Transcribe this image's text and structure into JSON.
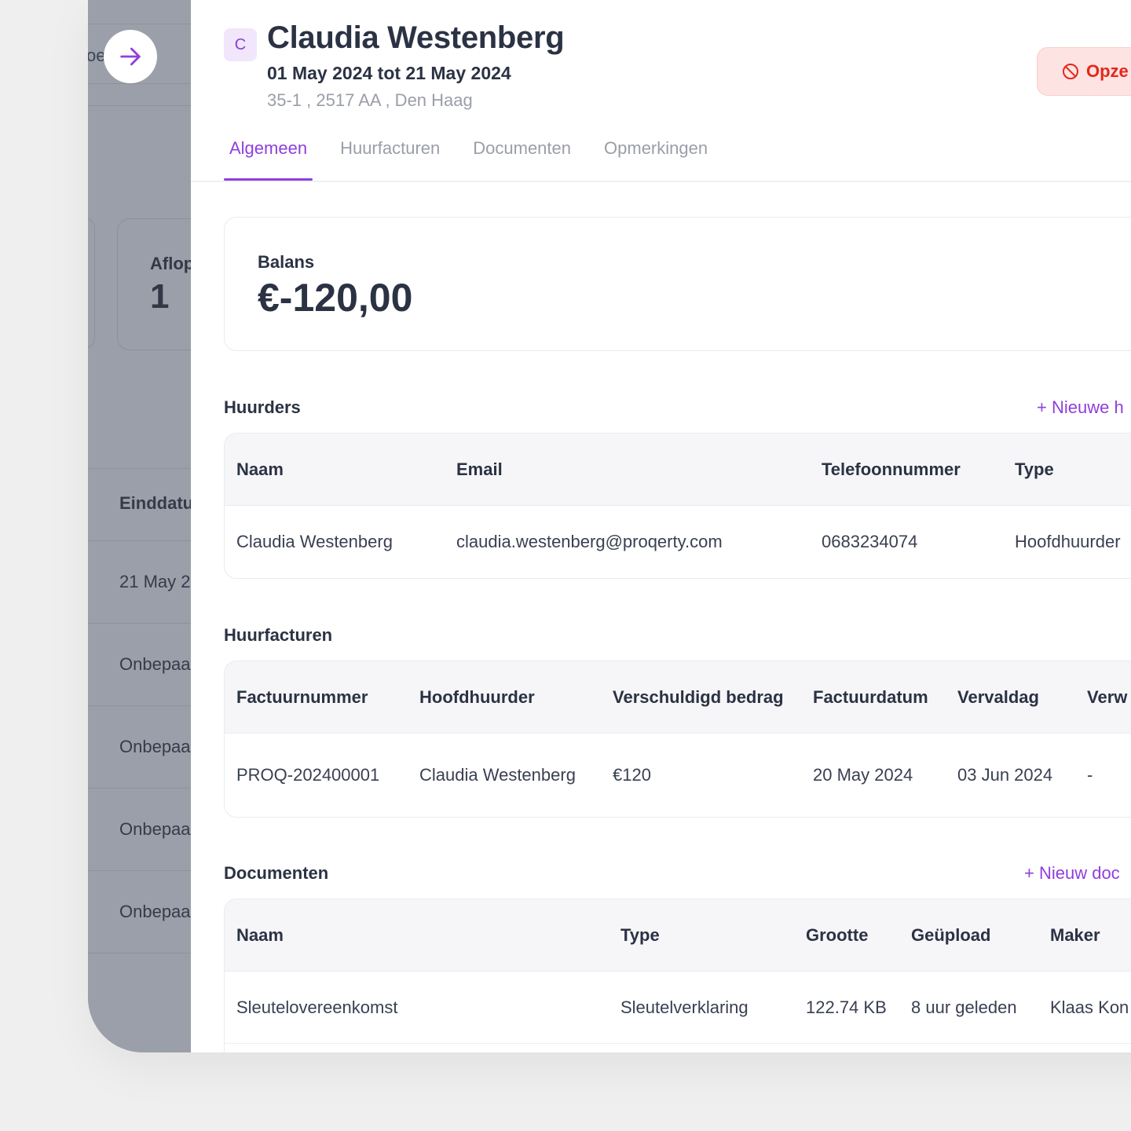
{
  "background": {
    "top_text": "oe",
    "card_label": "Aflop",
    "card_value": "1",
    "column_header": "Einddatu",
    "rows": [
      "21 May 2",
      "Onbepaa",
      "Onbepaa",
      "Onbepaa",
      "Onbepaa"
    ]
  },
  "header": {
    "avatar_initial": "C",
    "name": "Claudia Westenberg",
    "period": "01 May 2024 tot 21 May 2024",
    "address": "35-1 , 2517 AA , Den Haag",
    "cancel_label": "Opze"
  },
  "tabs": [
    {
      "label": "Algemeen",
      "active": true
    },
    {
      "label": "Huurfacturen",
      "active": false
    },
    {
      "label": "Documenten",
      "active": false
    },
    {
      "label": "Opmerkingen",
      "active": false
    }
  ],
  "balance": {
    "label": "Balans",
    "value": "€-120,00"
  },
  "tenants": {
    "title": "Huurders",
    "action": "+ Nieuwe h",
    "columns": [
      "Naam",
      "Email",
      "Telefoonnummer",
      "Type"
    ],
    "rows": [
      [
        "Claudia Westenberg",
        "claudia.westenberg@proqerty.com",
        "0683234074",
        "Hoofdhuurder"
      ]
    ]
  },
  "invoices": {
    "title": "Huurfacturen",
    "columns": [
      "Factuurnummer",
      "Hoofdhuurder",
      "Verschuldigd bedrag",
      "Factuurdatum",
      "Vervaldag",
      "Verw"
    ],
    "rows": [
      [
        "PROQ-202400001",
        "Claudia Westenberg",
        "€120",
        "20 May 2024",
        "03 Jun 2024",
        "-"
      ]
    ]
  },
  "documents": {
    "title": "Documenten",
    "action": "+ Nieuw doc",
    "columns": [
      "Naam",
      "Type",
      "Grootte",
      "Geüpload",
      "Maker"
    ],
    "rows": [
      [
        "Sleutelovereenkomst",
        "Sleutelverklaring",
        "122.74 KB",
        "8 uur geleden",
        "Klaas Kon"
      ]
    ]
  },
  "colors": {
    "accent": "#8f3fdb",
    "danger": "#e5261b",
    "overlay": "#9a9ea8"
  }
}
